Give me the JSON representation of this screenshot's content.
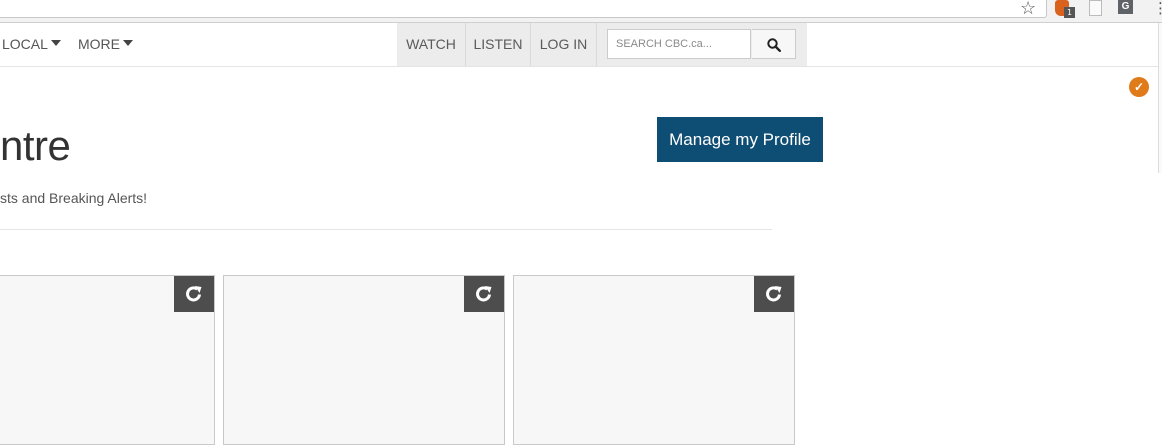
{
  "nav": {
    "local_label": "LOCAL",
    "more_label": "MORE",
    "watch_label": "WATCH",
    "listen_label": "LISTEN",
    "login_label": "LOG IN",
    "search_placeholder": "SEARCH CBC.ca..."
  },
  "page": {
    "title": "ntre",
    "subtitle": "sts and Breaking Alerts!",
    "manage_profile_label": "Manage my Profile"
  },
  "extensions": {
    "ublock_badge": "1",
    "g_label": "G"
  },
  "colors": {
    "manage_button_bg": "#0f4e74",
    "card_bg": "#f7f7f7",
    "refresh_button_bg": "#4d4d4d",
    "badge_orange": "#e07b1a"
  },
  "icons": {
    "bookmark": "star-icon",
    "search": "magnifier-icon",
    "refresh": "refresh-icon",
    "menu": "kebab-menu-icon"
  }
}
